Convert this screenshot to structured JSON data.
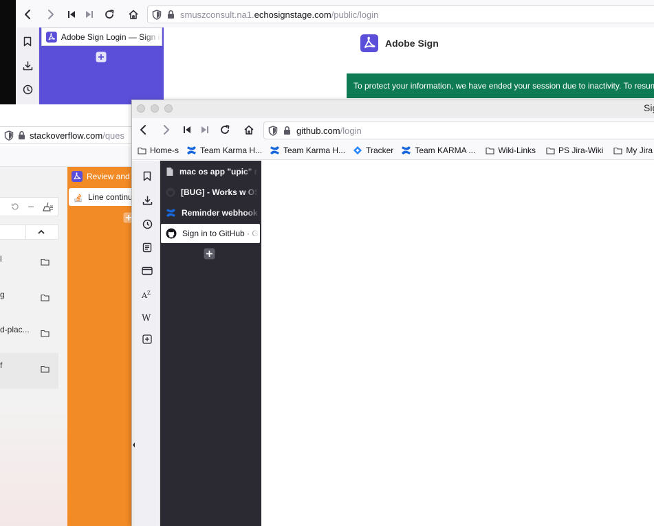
{
  "back_window": {
    "url_prefix": "smuszconsult.na1.",
    "url_domain": "echosignstage.com",
    "url_path": "/public/login",
    "tab_title": "Adobe Sign Login — Sign in",
    "brand": "Adobe Sign",
    "banner_text": "To protect your information, we have ended your session due to inactivity. To resume"
  },
  "middle_window": {
    "url_domain": "stackoverflow.com",
    "url_path": "/ques",
    "review_tab": "Review and",
    "line_tab": "Line continu",
    "rows": [
      {
        "label": "l"
      },
      {
        "label": "g"
      },
      {
        "label": "d-plac..."
      },
      {
        "label": "f"
      }
    ]
  },
  "front_window": {
    "title": "Sig",
    "url_domain": "github.com",
    "url_path": "/login",
    "bookmarks": [
      {
        "label": "Home-s",
        "icon": "folder-icon"
      },
      {
        "label": "Team Karma H...",
        "icon": "confluence-icon"
      },
      {
        "label": "Team Karma H...",
        "icon": "confluence-icon"
      },
      {
        "label": "Tracker",
        "icon": "jira-icon"
      },
      {
        "label": "Team KARMA ...",
        "icon": "confluence-icon"
      },
      {
        "label": "Wiki-Links",
        "icon": "folder-icon"
      },
      {
        "label": "PS Jira-Wiki",
        "icon": "folder-icon"
      },
      {
        "label": "My Jira",
        "icon": "folder-icon"
      }
    ],
    "tabs": [
      {
        "label": "mac os app \"upic\" not"
      },
      {
        "label": "[BUG] - Works w OS"
      },
      {
        "label": "Reminder webhook d"
      },
      {
        "label": "Sign in to GitHub · GitHub"
      }
    ]
  },
  "colors": {
    "adobe_purple": "#5b4fd9",
    "banner_green": "#0f7b54",
    "orange": "#f28a26",
    "dark_tabs": "#2b2a33",
    "confluence_blue": "#1868db"
  }
}
